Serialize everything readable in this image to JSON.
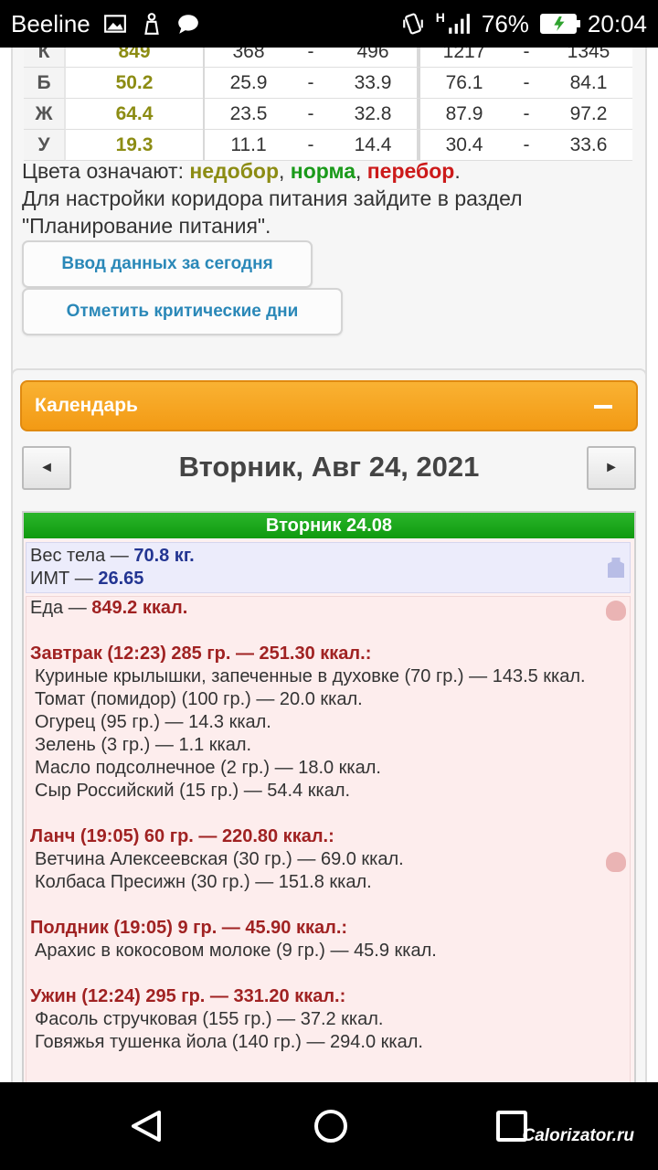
{
  "status_bar": {
    "carrier": "Beeline",
    "battery_percent": "76%",
    "time": "20:04",
    "network_type": "H"
  },
  "nutrients": [
    {
      "label": "К",
      "value": "849",
      "norm_min": "368",
      "norm_dash": "-",
      "norm_max": "496",
      "over_min": "1217",
      "over_dash": "-",
      "over_max": "1345"
    },
    {
      "label": "Б",
      "value": "50.2",
      "norm_min": "25.9",
      "norm_dash": "-",
      "norm_max": "33.9",
      "over_min": "76.1",
      "over_dash": "-",
      "over_max": "84.1"
    },
    {
      "label": "Ж",
      "value": "64.4",
      "norm_min": "23.5",
      "norm_dash": "-",
      "norm_max": "32.8",
      "over_min": "87.9",
      "over_dash": "-",
      "over_max": "97.2"
    },
    {
      "label": "У",
      "value": "19.3",
      "norm_min": "11.1",
      "norm_dash": "-",
      "norm_max": "14.4",
      "over_min": "30.4",
      "over_dash": "-",
      "over_max": "33.6"
    }
  ],
  "legend": {
    "prefix": "Цвета означают: ",
    "under": "недобор",
    "comma1": ", ",
    "norm": "норма",
    "comma2": ", ",
    "over": "перебор",
    "period": ".",
    "settings_text": "Для настройки коридора питания зайдите в раздел \"Планирование питания\"."
  },
  "buttons": {
    "enter_today": "Ввод данных за сегодня",
    "mark_critical": "Отметить критические дни"
  },
  "calendar": {
    "title": "Календарь",
    "prev": "◄",
    "next": "►",
    "date": "Вторник, Авг 24, 2021",
    "day_header": "Вторник 24.08"
  },
  "body_stats": {
    "weight_label": "Вес тела — ",
    "weight_value": "70.8 кг.",
    "bmi_label": "ИМТ — ",
    "bmi_value": "26.65"
  },
  "food": {
    "total_label": "Еда — ",
    "total_value": "849.2 ккал.",
    "meals": [
      {
        "title": "Завтрак (12:23) 285 гр. — 251.30 ккал.:",
        "items": [
          "Куриные крылышки, запеченные в духовке (70 гр.) — 143.5 ккал.",
          "Томат (помидор) (100 гр.) — 20.0 ккал.",
          "Огурец (95 гр.) — 14.3 ккал.",
          "Зелень (3 гр.) — 1.1 ккал.",
          "Масло подсолнечное (2 гр.) — 18.0 ккал.",
          "Сыр Российский (15 гр.) — 54.4 ккал."
        ]
      },
      {
        "title": "Ланч (19:05) 60 гр. — 220.80 ккал.:",
        "items": [
          "Ветчина Алексеевская (30 гр.) — 69.0 ккал.",
          "Колбаса Пресижн (30 гр.) — 151.8 ккал."
        ]
      },
      {
        "title": "Полдник (19:05) 9 гр. — 45.90 ккал.:",
        "items": [
          "Арахис в кокосовом молоке (9 гр.) — 45.9 ккал."
        ]
      },
      {
        "title": "Ужин (12:24) 295 гр. — 331.20 ккал.:",
        "items": [
          "Фасоль стручковая (155 гр.) — 37.2 ккал.",
          "Говяжья тушенка йола (140 гр.) — 294.0 ккал."
        ]
      }
    ]
  },
  "watermark": "Calorizator.ru",
  "colors": {
    "under": "#8c8c13",
    "norm": "#1a9a1a",
    "over": "#cc1a1a",
    "accent_orange": "#f39a14",
    "day_header_green": "#0f9a0f"
  },
  "icons": {
    "status_left": [
      "image-icon",
      "cleaner-icon",
      "chat-icon"
    ],
    "status_right": [
      "vibrate-icon",
      "signal-icon",
      "battery-charging-icon"
    ],
    "nav": [
      "back-icon",
      "home-icon",
      "recent-apps-icon"
    ]
  }
}
